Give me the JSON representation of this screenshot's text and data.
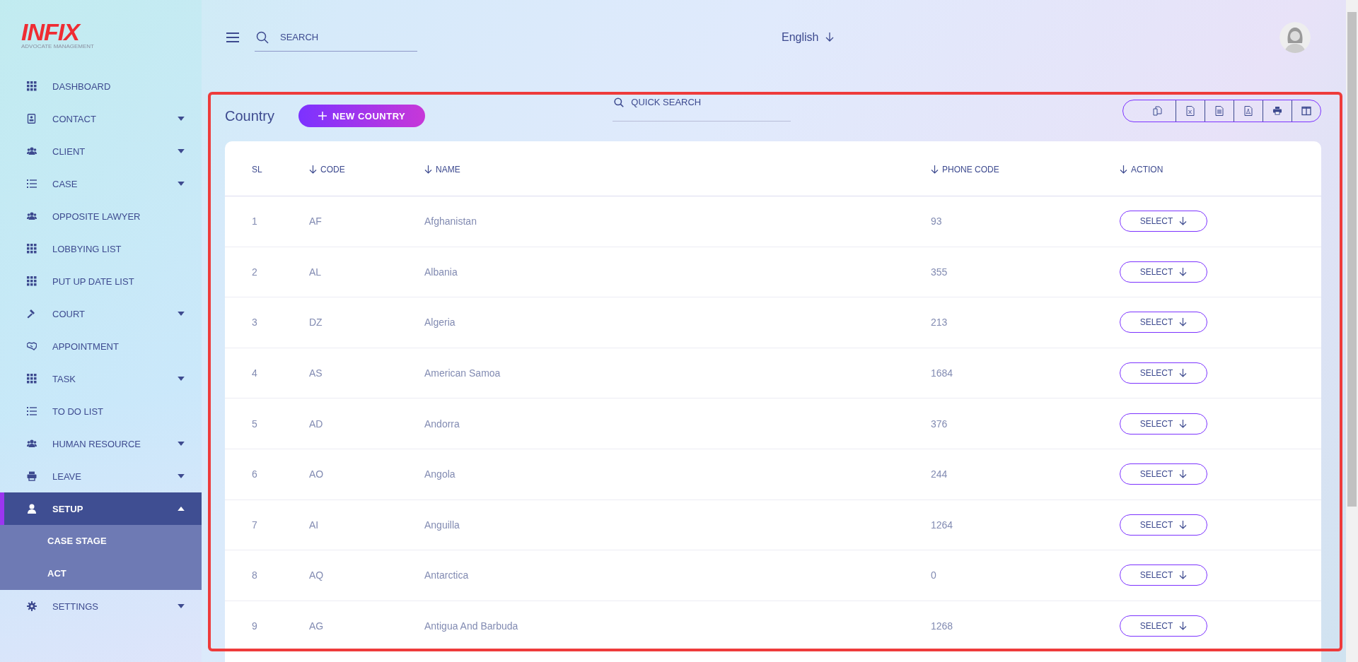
{
  "logo": {
    "text": "INFIX",
    "subtitle": "ADVOCATE MANAGEMENT"
  },
  "topbar": {
    "search": {
      "placeholder": "SEARCH"
    },
    "language": "English"
  },
  "sidebar": {
    "items": [
      {
        "label": "DASHBOARD",
        "selected": false
      },
      {
        "label": "CONTACT",
        "expanded": false,
        "selected": false
      },
      {
        "label": "CLIENT",
        "expanded": false,
        "selected": false
      },
      {
        "label": "CASE",
        "expanded": false,
        "selected": false
      },
      {
        "label": "OPPOSITE LAWYER",
        "selected": false
      },
      {
        "label": "LOBBYING LIST",
        "selected": false
      },
      {
        "label": "PUT UP DATE LIST",
        "selected": false
      },
      {
        "label": "COURT",
        "expanded": false,
        "selected": false
      },
      {
        "label": "APPOINTMENT",
        "selected": false
      },
      {
        "label": "TASK",
        "expanded": false,
        "selected": false
      },
      {
        "label": "TO DO LIST",
        "selected": false
      },
      {
        "label": "HUMAN RESOURCE",
        "expanded": false,
        "selected": false
      },
      {
        "label": "LEAVE",
        "expanded": false,
        "selected": false
      },
      {
        "label": "SETUP",
        "expanded": true,
        "selected": true,
        "children": [
          {
            "label": "CASE STAGE"
          },
          {
            "label": "ACT"
          }
        ]
      },
      {
        "label": "SETTINGS",
        "expanded": false,
        "selected": false
      }
    ]
  },
  "page": {
    "title": "Country",
    "new_button": "NEW COUNTRY",
    "quick_search": {
      "placeholder": "QUICK SEARCH"
    },
    "export_buttons": [
      {
        "kind": "copy"
      },
      {
        "kind": "excel"
      },
      {
        "kind": "csv"
      },
      {
        "kind": "pdf"
      },
      {
        "kind": "print"
      },
      {
        "kind": "columns"
      }
    ]
  },
  "table": {
    "columns": [
      {
        "label": "SL",
        "sortable": false
      },
      {
        "label": "CODE",
        "sortable": true
      },
      {
        "label": "NAME",
        "sortable": true
      },
      {
        "label": "PHONE CODE",
        "sortable": true
      },
      {
        "label": "ACTION",
        "sortable": true
      }
    ],
    "rows": [
      {
        "sl": "1",
        "code": "AF",
        "name": "Afghanistan",
        "phone_code": "93",
        "action": "SELECT"
      },
      {
        "sl": "2",
        "code": "AL",
        "name": "Albania",
        "phone_code": "355",
        "action": "SELECT"
      },
      {
        "sl": "3",
        "code": "DZ",
        "name": "Algeria",
        "phone_code": "213",
        "action": "SELECT"
      },
      {
        "sl": "4",
        "code": "AS",
        "name": "American Samoa",
        "phone_code": "1684",
        "action": "SELECT"
      },
      {
        "sl": "5",
        "code": "AD",
        "name": "Andorra",
        "phone_code": "376",
        "action": "SELECT"
      },
      {
        "sl": "6",
        "code": "AO",
        "name": "Angola",
        "phone_code": "244",
        "action": "SELECT"
      },
      {
        "sl": "7",
        "code": "AI",
        "name": "Anguilla",
        "phone_code": "1264",
        "action": "SELECT"
      },
      {
        "sl": "8",
        "code": "AQ",
        "name": "Antarctica",
        "phone_code": "0",
        "action": "SELECT"
      },
      {
        "sl": "9",
        "code": "AG",
        "name": "Antigua And Barbuda",
        "phone_code": "1268",
        "action": "SELECT"
      }
    ]
  }
}
